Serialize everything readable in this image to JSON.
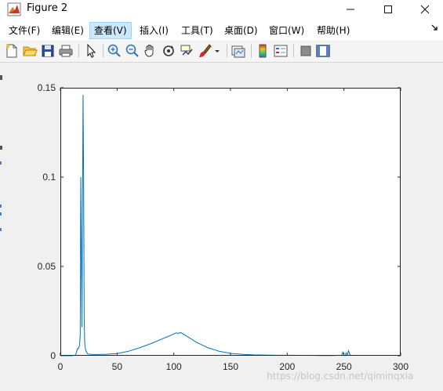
{
  "window": {
    "title": "Figure 2"
  },
  "menu": {
    "items": [
      "文件(F)",
      "编辑(E)",
      "查看(V)",
      "插入(I)",
      "工具(T)",
      "桌面(D)",
      "窗口(W)",
      "帮助(H)"
    ],
    "active": "查看(V)"
  },
  "toolbar": {
    "icons": [
      "new-figure-icon",
      "open-file-icon",
      "save-icon",
      "print-icon",
      "pointer-icon",
      "zoom-in-icon",
      "zoom-out-icon",
      "pan-icon",
      "rotate-3d-icon",
      "data-cursor-icon",
      "brush-icon",
      "link-plot-icon",
      "insert-colorbar-icon",
      "insert-legend-icon",
      "hide-plot-tools-icon",
      "show-plot-tools-icon"
    ]
  },
  "watermark": "https://blog.csdn.net/qiminqxia",
  "colors": {
    "series": "#0072bd",
    "axes_bg": "#ffffff",
    "figure_bg": "#f0f0f0"
  },
  "chart_data": {
    "type": "line",
    "title": "",
    "xlabel": "",
    "ylabel": "",
    "xlim": [
      0,
      300
    ],
    "ylim": [
      0,
      0.15
    ],
    "xticks": [
      0,
      50,
      100,
      150,
      200,
      250,
      300
    ],
    "yticks": [
      0,
      0.05,
      0.1,
      0.15
    ],
    "ytick_labels": [
      "0",
      "0.05",
      "0.1",
      "0.15"
    ],
    "grid": false,
    "series": [
      {
        "x": [
          0,
          10,
          13,
          14,
          15,
          16,
          17,
          17.5,
          18,
          18.5,
          19,
          19.5,
          20,
          20.5,
          21,
          21.5,
          22,
          23,
          24,
          26,
          30,
          40,
          50,
          60,
          70,
          80,
          90,
          95,
          100,
          102,
          104,
          106,
          110,
          115,
          120,
          130,
          140,
          150,
          160,
          170,
          180,
          190,
          200,
          210,
          220,
          230,
          240,
          248,
          249,
          250,
          251,
          252,
          253,
          254,
          255,
          256
        ],
        "y": [
          0,
          0,
          0.0003,
          0.0015,
          0.004,
          0.004,
          0.006,
          0.012,
          0.1,
          0.06,
          0.016,
          0.08,
          0.146,
          0.1,
          0.02,
          0.007,
          0.004,
          0.002,
          0.001,
          0.0008,
          0.0007,
          0.0008,
          0.0012,
          0.0025,
          0.0045,
          0.0068,
          0.0095,
          0.0108,
          0.0122,
          0.0128,
          0.0125,
          0.013,
          0.0115,
          0.0095,
          0.0075,
          0.0045,
          0.0025,
          0.0013,
          0.0008,
          0.0005,
          0.0004,
          0.0003,
          0.0003,
          0.0002,
          0.0002,
          0.0001,
          0.0001,
          0.0003,
          0.002,
          0.0002,
          0.0001,
          0.0016,
          0.0005,
          0.0028,
          0.001,
          0
        ]
      }
    ]
  }
}
